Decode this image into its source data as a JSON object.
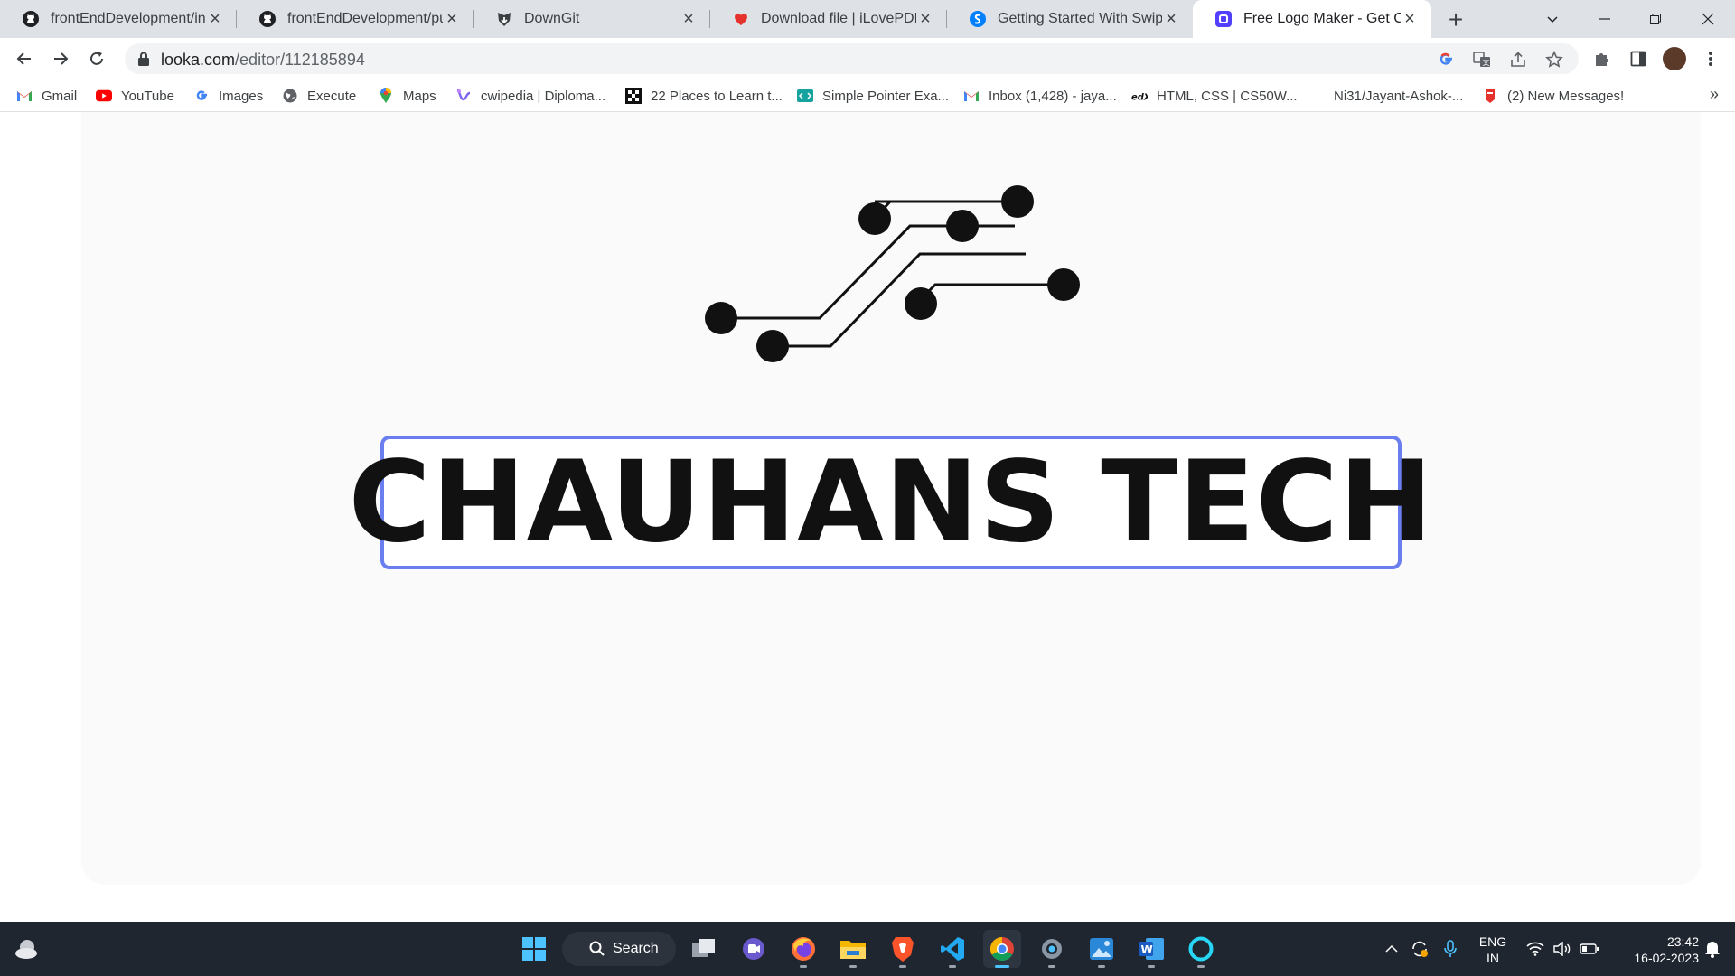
{
  "browser": {
    "tabs": [
      {
        "title": "frontEndDevelopment/inde",
        "icon": "github-icon"
      },
      {
        "title": "frontEndDevelopment/publ",
        "icon": "github-icon"
      },
      {
        "title": "DownGit",
        "icon": "downgit-icon"
      },
      {
        "title": "Download file | iLovePDF",
        "icon": "ilovepdf-icon"
      },
      {
        "title": "Getting Started With Swipe",
        "icon": "swiper-icon"
      },
      {
        "title": "Free Logo Maker - Get Cust",
        "icon": "looka-icon",
        "active": true
      }
    ],
    "address": {
      "domain": "looka.com",
      "path": "/editor/112185894"
    },
    "bookmarks": [
      {
        "label": "Gmail",
        "icon": "gmail-icon"
      },
      {
        "label": "YouTube",
        "icon": "youtube-icon"
      },
      {
        "label": "Images",
        "icon": "google-icon"
      },
      {
        "label": "Execute",
        "icon": "globe-icon"
      },
      {
        "label": "Maps",
        "icon": "maps-icon"
      },
      {
        "label": "cwipedia | Diploma...",
        "icon": "cwipedia-icon"
      },
      {
        "label": "22 Places to Learn t...",
        "icon": "places-icon"
      },
      {
        "label": "Simple Pointer Exa...",
        "icon": "code-icon"
      },
      {
        "label": "Inbox (1,428) - jaya...",
        "icon": "gmail-icon"
      },
      {
        "label": "HTML, CSS | CS50W...",
        "icon": "cs50-icon"
      },
      {
        "label": "Ni31/Jayant-Ashok-...",
        "icon": "blank-icon"
      },
      {
        "label": "(2) New Messages!",
        "icon": "messages-icon"
      }
    ],
    "bookmarks_more": "»"
  },
  "editor": {
    "brand_name": "CHAUHANS TECH",
    "selection_color": "#6b7ef0",
    "logo_icon": "circuit-traces-icon"
  },
  "taskbar": {
    "search_label": "Search",
    "apps": [
      {
        "name": "task-view",
        "icon": "task-view-icon"
      },
      {
        "name": "teams-chat",
        "icon": "chat-icon"
      },
      {
        "name": "firefox",
        "icon": "firefox-icon"
      },
      {
        "name": "file-explorer",
        "icon": "folder-icon"
      },
      {
        "name": "brave",
        "icon": "brave-icon"
      },
      {
        "name": "vscode",
        "icon": "vscode-icon"
      },
      {
        "name": "chrome",
        "icon": "chrome-icon",
        "active": true
      },
      {
        "name": "settings",
        "icon": "settings-icon"
      },
      {
        "name": "photos",
        "icon": "photos-icon"
      },
      {
        "name": "word",
        "icon": "word-icon"
      },
      {
        "name": "cortana",
        "icon": "cortana-icon"
      }
    ],
    "lang_line1": "ENG",
    "lang_line2": "IN",
    "time": "23:42",
    "date": "16-02-2023"
  }
}
